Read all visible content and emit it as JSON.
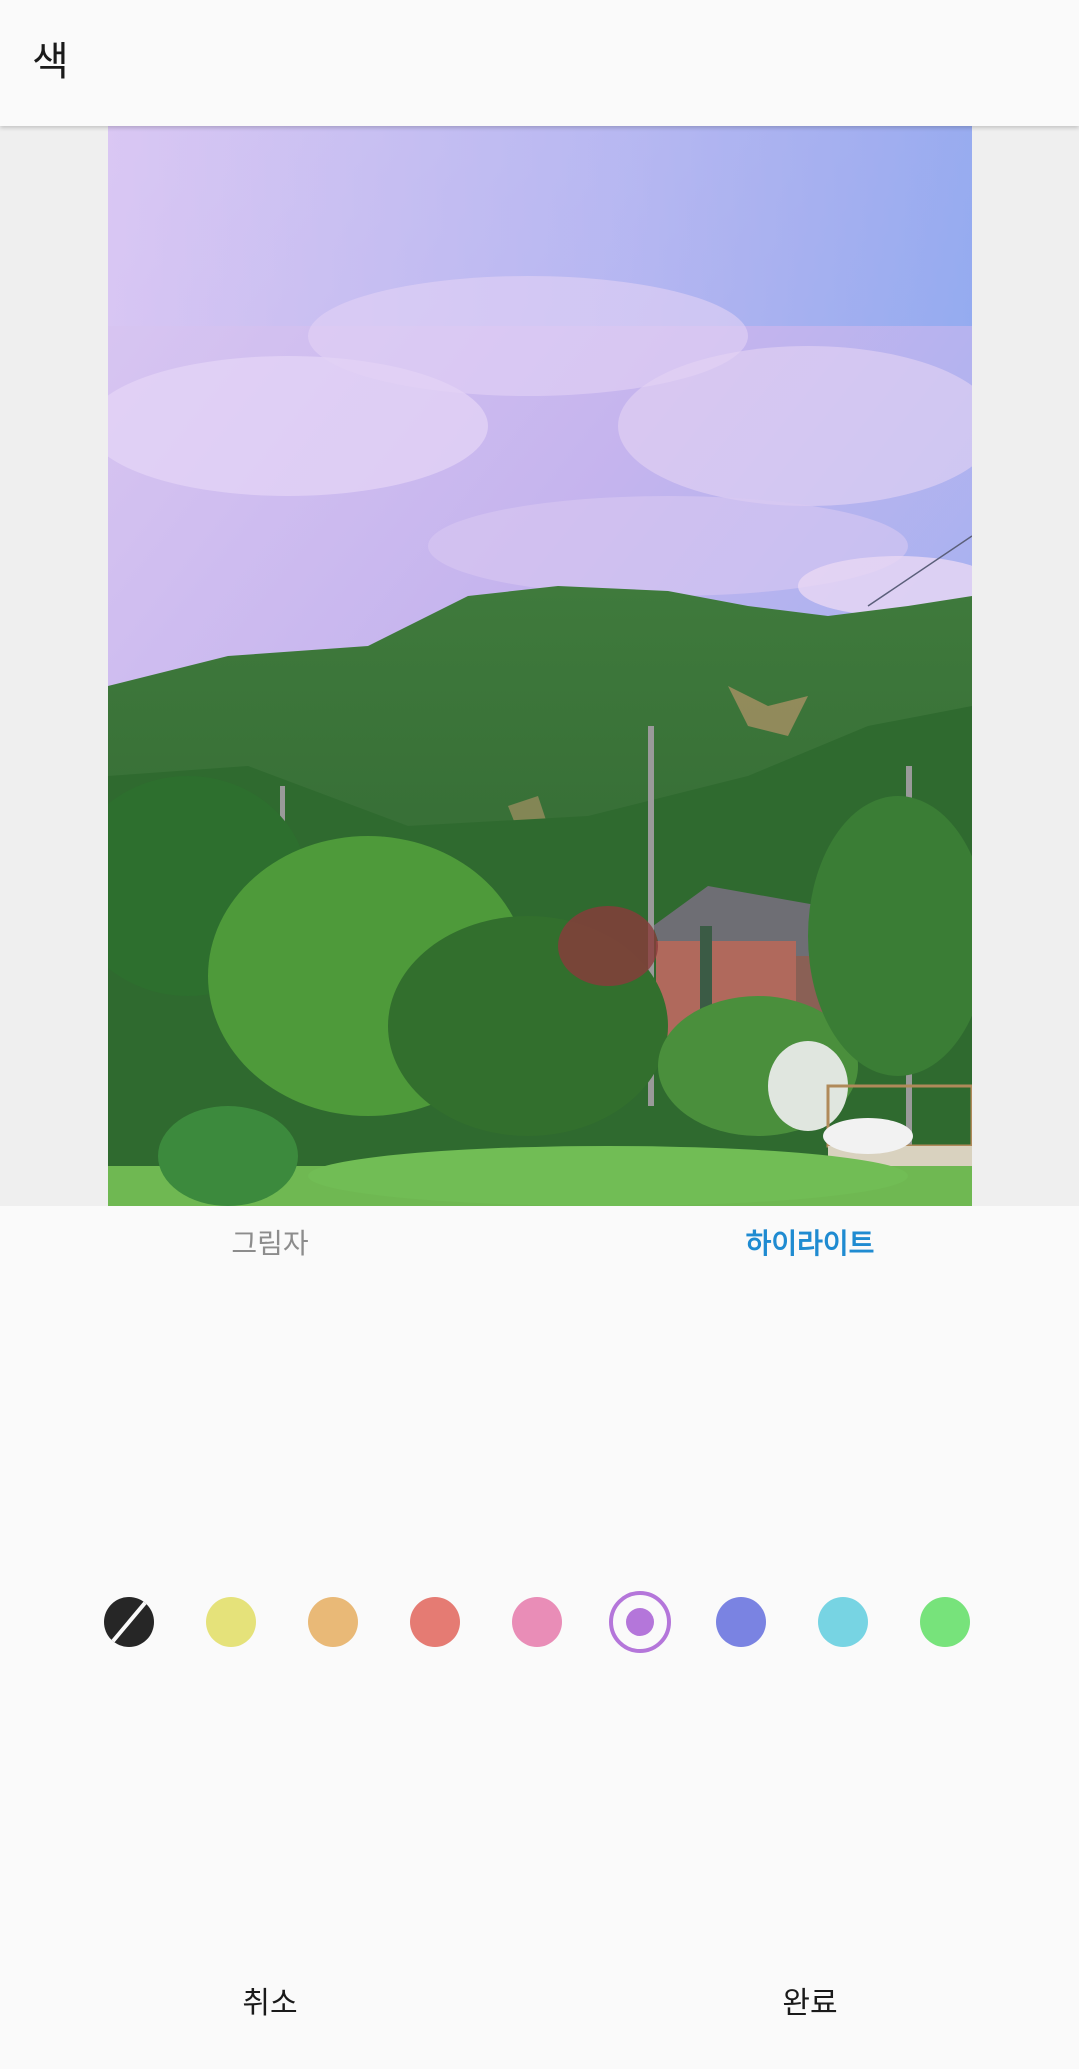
{
  "header": {
    "title": "색"
  },
  "photo": {
    "description_icon": "landscape-photo"
  },
  "tabs": [
    {
      "label": "그림자",
      "active": false
    },
    {
      "label": "하이라이트",
      "active": true
    }
  ],
  "colors": {
    "accent": "#1f8bd1",
    "swatches": [
      "none",
      "#e5e27a",
      "#e9b977",
      "#e57b73",
      "#e98db7",
      "#b476da",
      "#7a83e2",
      "#77d4e3",
      "#77e37b"
    ],
    "selected_index": 5
  },
  "bottom": {
    "cancel_label": "취소",
    "done_label": "완료"
  }
}
